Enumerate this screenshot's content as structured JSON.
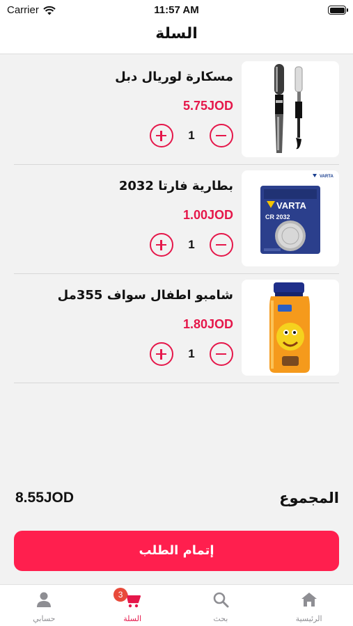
{
  "status_bar": {
    "carrier": "Carrier",
    "time": "11:57 AM"
  },
  "header": {
    "title": "السلة"
  },
  "cart": {
    "items": [
      {
        "name": "مسكارة لوريال دبل",
        "price": "5.75JOD",
        "quantity": "1",
        "icon": "mascara-image"
      },
      {
        "name": "بطارية فارتا 2032",
        "price": "1.00JOD",
        "quantity": "1",
        "icon": "battery-image",
        "brand_text": "VARTA",
        "model_text": "CR 2032"
      },
      {
        "name": "شامبو اطفال سواف 355مل",
        "price": "1.80JOD",
        "quantity": "1",
        "icon": "shampoo-image"
      }
    ]
  },
  "summary": {
    "total_label": "المجموع",
    "total_value": "8.55JOD"
  },
  "checkout_label": "إتمام الطلب",
  "tab_bar": {
    "account": "حسابي",
    "cart": "السلة",
    "cart_badge": "3",
    "search": "بحث",
    "home": "الرئيسية"
  },
  "colors": {
    "accent": "#e5174a",
    "button": "#ff1f4e",
    "badge": "#e84a3a"
  }
}
